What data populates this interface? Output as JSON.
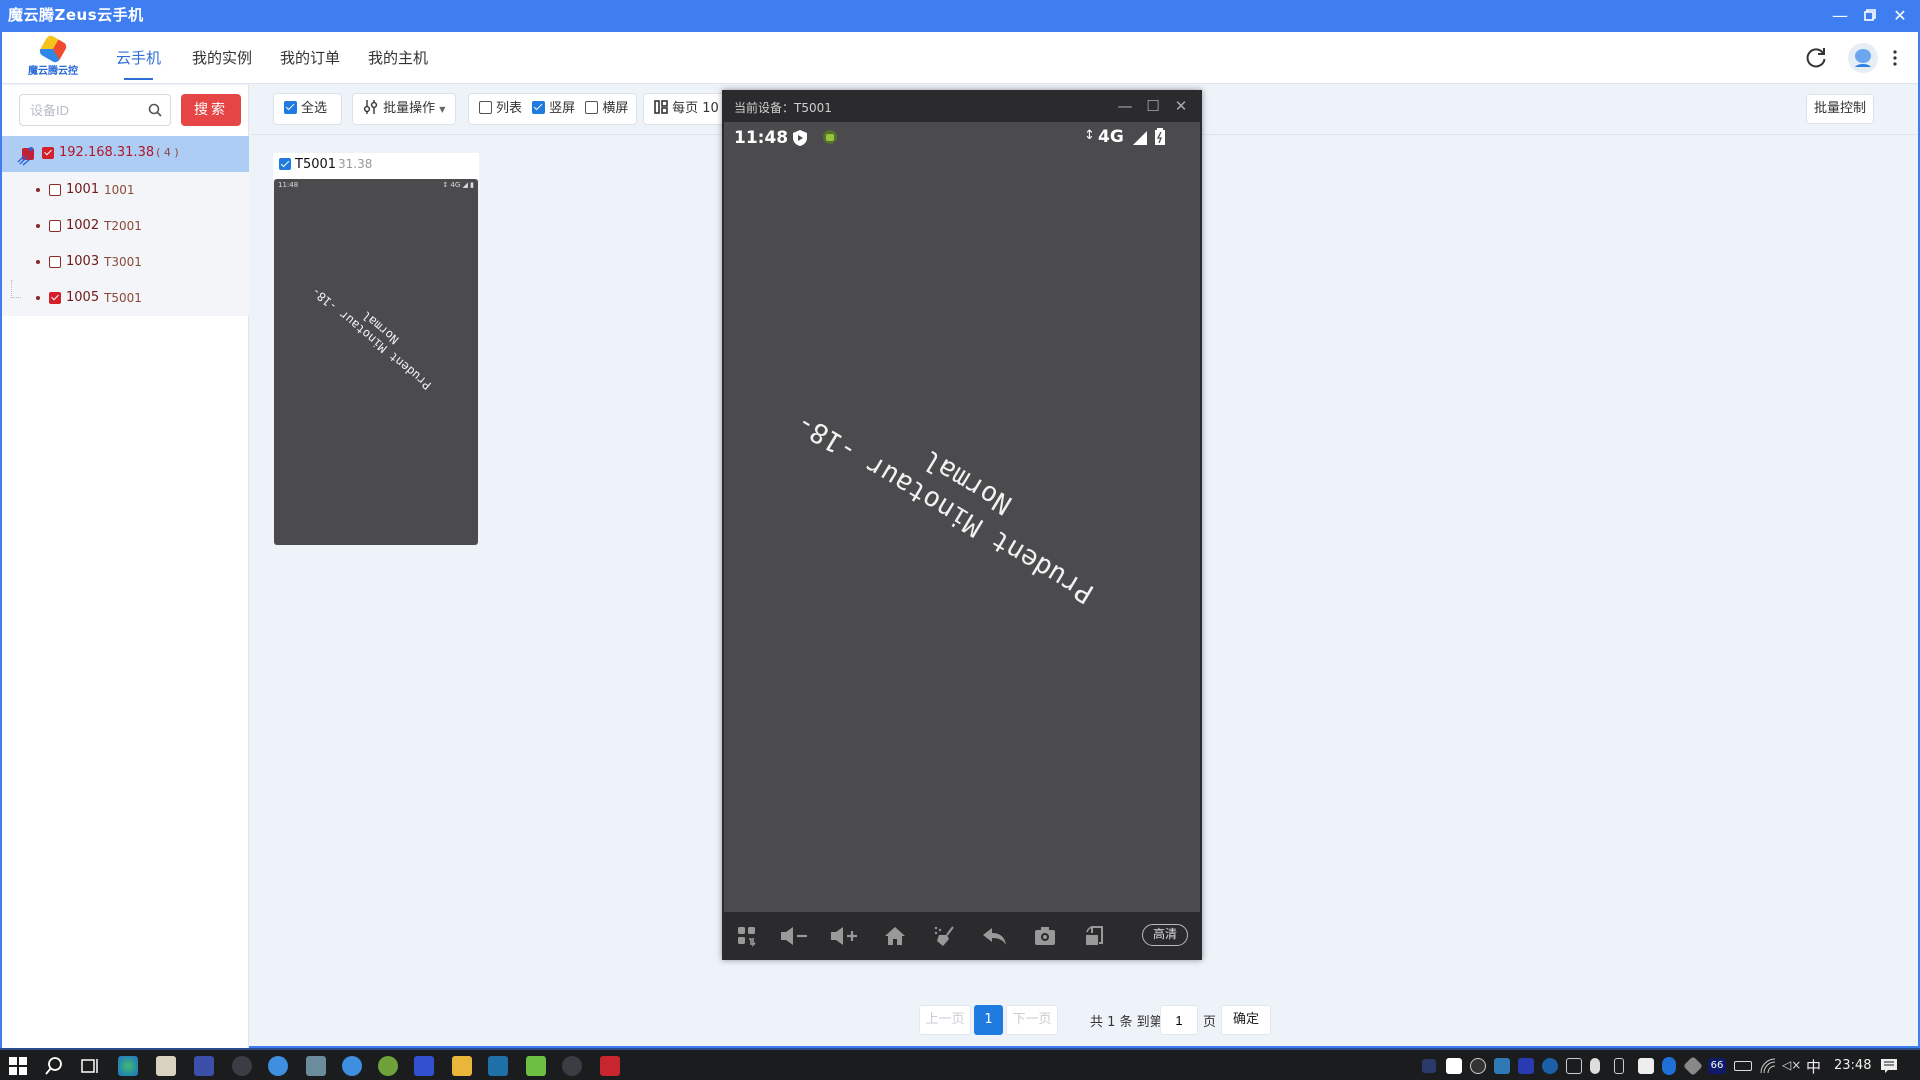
{
  "window": {
    "title": "魔云腾Zeus云手机",
    "controls": [
      "minimize",
      "restore",
      "close"
    ]
  },
  "header": {
    "logo_text": "魔云腾云控",
    "nav": [
      {
        "label": "云手机",
        "active": true
      },
      {
        "label": "我的实例",
        "active": false
      },
      {
        "label": "我的订单",
        "active": false
      },
      {
        "label": "我的主机",
        "active": false
      }
    ],
    "icons": [
      "refresh-icon",
      "avatar",
      "more-vertical-icon"
    ]
  },
  "sidebar": {
    "search_placeholder": "设备ID",
    "search_value": "",
    "search_button": "搜索",
    "host": {
      "ip": "192.168.31.38",
      "count": "( 4 )",
      "checked": true
    },
    "devices": [
      {
        "id": "1001",
        "name": "1001",
        "checked": false
      },
      {
        "id": "1002",
        "name": "T2001",
        "checked": false
      },
      {
        "id": "1003",
        "name": "T3001",
        "checked": false
      },
      {
        "id": "1005",
        "name": "T5001",
        "checked": true
      }
    ]
  },
  "toolbar": {
    "select_all": {
      "label": "全选",
      "checked": true
    },
    "batch_ops": "批量操作",
    "view_list": {
      "label": "列表",
      "checked": false
    },
    "view_portrait": {
      "label": "竖屏",
      "checked": true
    },
    "view_landscape": {
      "label": "横屏",
      "checked": false
    },
    "per_page": "每页 10",
    "batch_control": "批量控制"
  },
  "card": {
    "name": "T5001",
    "sub": "31.38",
    "checked": true,
    "status": {
      "time": "11:48",
      "network": "4G"
    }
  },
  "phone_window": {
    "title": "当前设备：T5001",
    "status_time": "11:48",
    "network": "4G",
    "screen_text_line1": "Prudent Minotaur -18-",
    "screen_text_line2": "Normal",
    "nav_buttons": [
      "apps-icon",
      "volume-down-icon",
      "volume-up-icon",
      "home-icon",
      "clean-icon",
      "back-icon",
      "camera-icon",
      "rotate-icon"
    ],
    "quality_button": "高清"
  },
  "pagination": {
    "prev": "上一页",
    "current": "1",
    "next": "下一页",
    "total_text": "共 1 条 到第",
    "goto_value": "1",
    "page_suffix": "页",
    "confirm": "确定"
  },
  "taskbar": {
    "clock": "23:48",
    "ime": "中",
    "badge": "66"
  }
}
